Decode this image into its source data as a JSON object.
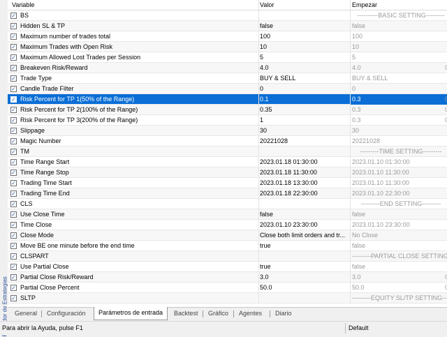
{
  "side_tab": "Probador de Estrategias",
  "columns": {
    "variable": "Variable",
    "valor": "Valor",
    "empezar": "Empezar"
  },
  "rows": [
    {
      "name": "BS",
      "valor": "",
      "empezar": "----------BASIC SETTING---------",
      "group": true,
      "extra": ""
    },
    {
      "name": "Hidden SL & TP",
      "valor": "false",
      "empezar": "false",
      "extra": ""
    },
    {
      "name": "Maximum number of trades total",
      "valor": "100",
      "empezar": "100",
      "extra": ""
    },
    {
      "name": "Maximum Trades with Open Risk",
      "valor": "10",
      "empezar": "10",
      "extra": ""
    },
    {
      "name": "Maximum Allowed Lost Trades per Session",
      "valor": "5",
      "empezar": "5",
      "extra": ""
    },
    {
      "name": "Breakeven Risk/Reward",
      "valor": "4.0",
      "empezar": "4.0",
      "extra": "0"
    },
    {
      "name": "Trade Type",
      "valor": "BUY & SELL",
      "empezar": "BUY & SELL",
      "extra": ""
    },
    {
      "name": "Candle Trade Filter",
      "valor": "0",
      "empezar": "0",
      "extra": ""
    },
    {
      "name": "Risk Percent for TP 1(50% of the Range)",
      "valor": "0.1",
      "empezar": "0.3",
      "extra": "0",
      "selected": true
    },
    {
      "name": "Risk Percent for TP 2(100% of the Range)",
      "valor": "0.35",
      "empezar": "0.3",
      "extra": "0"
    },
    {
      "name": "Risk Percent for TP 3(200% of the Range)",
      "valor": "1",
      "empezar": "0.3",
      "extra": "0"
    },
    {
      "name": "Slippage",
      "valor": "30",
      "empezar": "30",
      "extra": ""
    },
    {
      "name": "Magic Number",
      "valor": "20221028",
      "empezar": "20221028",
      "extra": ""
    },
    {
      "name": "TM",
      "valor": "",
      "empezar": "---------TIME SETTING---------",
      "group": true,
      "extra": ""
    },
    {
      "name": "Time Range Start",
      "valor": "2023.01.18 01:30:00",
      "empezar": "2023.01.10 01:30:00",
      "extra": ""
    },
    {
      "name": "Time Range Stop",
      "valor": "2023.01.18 11:30:00",
      "empezar": "2023.01.10 11:30:00",
      "extra": ""
    },
    {
      "name": "Trading Time Start",
      "valor": "2023.01.18 13:30:00",
      "empezar": "2023.01.10 11:30:00",
      "extra": ""
    },
    {
      "name": "Trading Time End",
      "valor": "2023.01.18 22:30:00",
      "empezar": "2023.01.10 22:30:00",
      "extra": ""
    },
    {
      "name": "CLS",
      "valor": "",
      "empezar": "---------END SETTING---------",
      "group": true,
      "extra": ""
    },
    {
      "name": "Use Close Time",
      "valor": "false",
      "empezar": "false",
      "extra": ""
    },
    {
      "name": "Time Close",
      "valor": "2023.01.10 23:30:00",
      "empezar": "2023.01.10 23:30:00",
      "extra": ""
    },
    {
      "name": "Close Mode",
      "valor": "Close both limit orders and tr...",
      "empezar": "No Close",
      "extra": ""
    },
    {
      "name": "Move BE one minute before the end time",
      "valor": "true",
      "empezar": "false",
      "extra": ""
    },
    {
      "name": "CLSPART",
      "valor": "",
      "empezar": "---------PARTIAL CLOSE SETTING---------",
      "group": true,
      "extra": ""
    },
    {
      "name": "Use Partial Close",
      "valor": "true",
      "empezar": "false",
      "extra": ""
    },
    {
      "name": "Partial Close Risk/Reward",
      "valor": "3.0",
      "empezar": "3.0",
      "extra": "0"
    },
    {
      "name": "Partial Close Percent",
      "valor": "50.0",
      "empezar": "50.0",
      "extra": "0"
    },
    {
      "name": "SLTP",
      "valor": "",
      "empezar": "---------EQUITY SL/TP SETTING---------",
      "group": true,
      "extra": ""
    }
  ],
  "bottom_tabs": [
    "General",
    "Configuración",
    "Parámetros de entrada",
    "Backtest",
    "Gráfico",
    "Agentes",
    "Diario"
  ],
  "active_tab": "Parámetros de entrada",
  "status": {
    "help": "Para abrir la Ayuda, pulse F1",
    "profile": "Default"
  }
}
